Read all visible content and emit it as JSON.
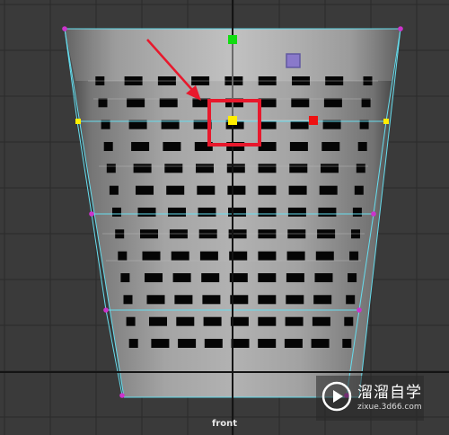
{
  "viewport": {
    "camera_label": "front",
    "background_color": "#3a3a3a",
    "grid_color": "#2a2a2a",
    "axis_color": "#141414"
  },
  "model": {
    "hole_rows": 13,
    "hole_columns": 9,
    "wire_color": "#66ddee",
    "vertex_color": "#cc33cc"
  },
  "manipulator": {
    "center_handle_color": "#ffee00",
    "x_handle_color": "#ee1111",
    "y_handle_color": "#11dd11",
    "z_handle_color": "#8877cc"
  },
  "annotation": {
    "color": "#e8182c"
  },
  "watermark": {
    "title": "溜溜自学",
    "url": "zixue.3d66.com",
    "logo_icon": "play-icon"
  }
}
